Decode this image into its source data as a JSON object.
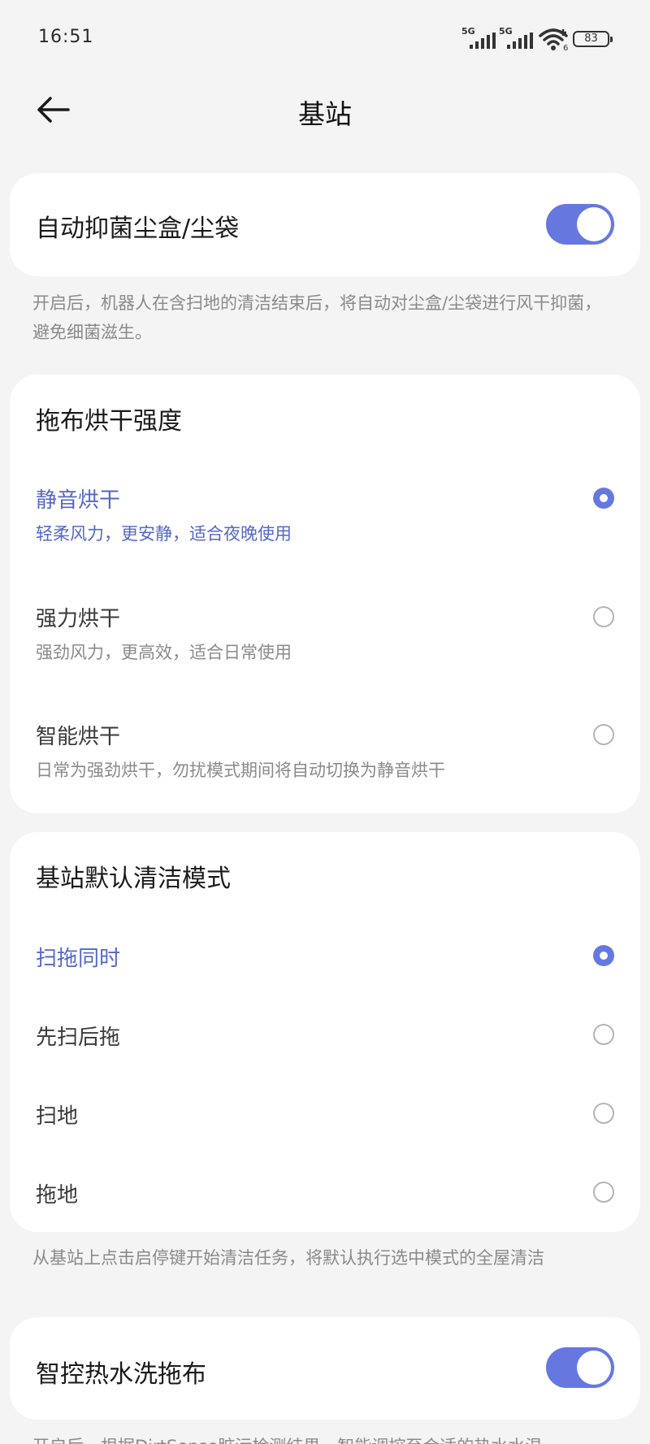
{
  "status_bar": {
    "time": "16:51",
    "sim1": "5G",
    "sim2": "5G",
    "wifi_badge": "6",
    "battery": "83"
  },
  "header": {
    "title": "基站",
    "back_icon": "arrow-left-icon"
  },
  "card_auto_sterilize": {
    "label": "自动抑菌尘盒/尘袋",
    "enabled": true,
    "note": "开启后，机器人在含扫地的清洁结束后，将自动对尘盒/尘袋进行风干抑菌，避免细菌滋生。"
  },
  "mop_dry": {
    "title": "拖布烘干强度",
    "options": [
      {
        "name": "静音烘干",
        "desc": "轻柔风力，更安静，适合夜晚使用",
        "selected": true
      },
      {
        "name": "强力烘干",
        "desc": "强劲风力，更高效，适合日常使用",
        "selected": false
      },
      {
        "name": "智能烘干",
        "desc": "日常为强劲烘干，勿扰模式期间将自动切换为静音烘干",
        "selected": false
      }
    ]
  },
  "clean_mode": {
    "title": "基站默认清洁模式",
    "options": [
      {
        "name": "扫拖同时",
        "selected": true
      },
      {
        "name": "先扫后拖",
        "selected": false
      },
      {
        "name": "扫地",
        "selected": false
      },
      {
        "name": "拖地",
        "selected": false
      }
    ],
    "note": "从基站上点击启停键开始清洁任务，将默认执行选中模式的全屋清洁"
  },
  "hot_water": {
    "label": "智控热水洗拖布",
    "enabled": true,
    "note_partial": "开启后，根据DirtSense脏污检测结果，智能调控至合适的热水水温"
  },
  "colors": {
    "accent": "#6678e0",
    "selected_text": "#5567c8",
    "background": "#f4f4f5"
  }
}
